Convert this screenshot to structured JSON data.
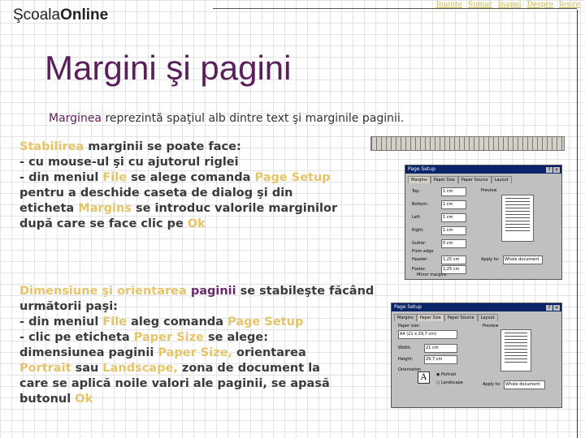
{
  "logo": {
    "part1": "Şcoala",
    "part2": "Online"
  },
  "nav": [
    "Inainte",
    "Sumar",
    "Inapoi",
    "Despre",
    "Iesire"
  ],
  "title": "Margini şi pagini",
  "intro": {
    "keyword": "Marginea",
    "rest": " reprezintă spaţiul alb dintre text şi marginile paginii."
  },
  "block1": {
    "l1_a": "Stabilirea",
    "l1_b": " marginii se poate face:",
    "l2": "- cu mouse-ul şi cu ajutorul riglei",
    "l3_a": "- din meniul ",
    "l3_b": "File",
    "l3_c": " se alege comanda ",
    "l3_d": "Page Setup",
    "l4": "pentru a deschide caseta de dialog şi din",
    "l5_a": "eticheta ",
    "l5_b": "Margins",
    "l5_c": " se introduc valorile marginilor",
    "l6_a": "după care se face clic pe ",
    "l6_b": "Ok"
  },
  "block2": {
    "l1_a": "Dimensiune şi orientarea",
    "l1_b": " paginii",
    "l1_c": " se stabileşte făcând",
    "l2": "următorii paşi:",
    "l3_a": " - din meniul ",
    "l3_b": "File",
    "l3_c": " aleg comanda ",
    "l3_d": "Page Setup",
    "l4_a": "- clic pe eticheta ",
    "l4_b": "Paper Size",
    "l4_c": " se alege:",
    "l5_a": "dimensiunea paginii ",
    "l5_b": "Paper Size,",
    "l5_c": " orientarea",
    "l6_a": "Portrait",
    "l6_b": " sau ",
    "l6_c": "Landscape,",
    "l6_d": " zona de document la",
    "l7": "care se aplică  noile valori ale paginii, se apasă",
    "l8_a": "butonul ",
    "l8_b": "Ok"
  },
  "dialog1": {
    "title": "Page Setup",
    "tabs": [
      "Margins",
      "Paper Size",
      "Paper Source",
      "Layout"
    ],
    "labels": [
      "Top:",
      "Bottom:",
      "Left:",
      "Right:",
      "Gutter:",
      "From edge",
      "Header:",
      "Footer:",
      "Mirror margins",
      "Preview",
      "Apply to:"
    ],
    "values": [
      "1 cm",
      "1 cm",
      "1 cm",
      "1 cm",
      "0 cm",
      "1,25 cm",
      "1,25 cm"
    ],
    "apply_to": "Whole document"
  },
  "dialog2": {
    "title": "Page Setup",
    "tabs": [
      "Margins",
      "Paper Size",
      "Paper Source",
      "Layout"
    ],
    "labels": [
      "Paper size:",
      "Width:",
      "Height:",
      "Orientation",
      "Portrait",
      "Landscape",
      "Preview",
      "Apply to:"
    ],
    "values": [
      "A4 (21 x 29,7 cm)",
      "21 cm",
      "29,7 cm"
    ],
    "apply_to": "Whole document"
  }
}
